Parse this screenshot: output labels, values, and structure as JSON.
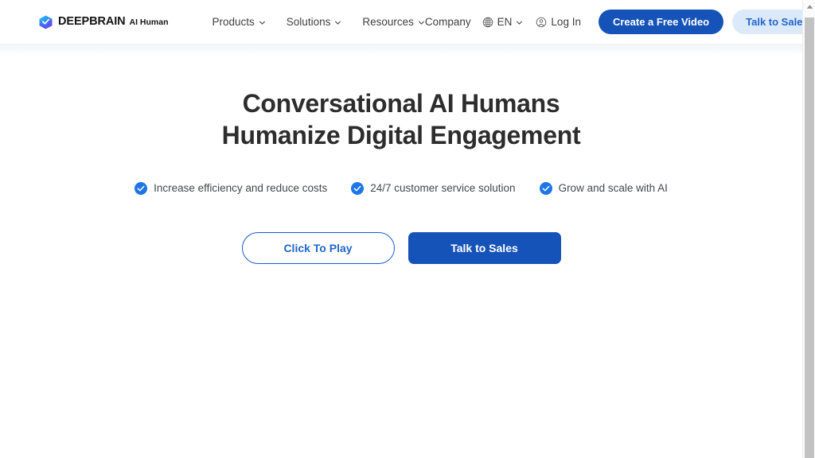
{
  "brand": {
    "logo_icon": "deepbrain-cube-icon",
    "name": "DEEPBRAIN",
    "product": "AI Human",
    "colors": {
      "primary_blue": "#1653b8",
      "link_blue": "#2266cc",
      "soft_blue_bg": "#dce9fa",
      "outline_blue": "#1a5bc4",
      "check_blue": "#1d75e8",
      "heading": "#2d2d2d",
      "body_text": "#44474d",
      "nav_text": "#3f3f3f"
    }
  },
  "header": {
    "nav": [
      {
        "label": "Products",
        "icon": "chevron-down-icon"
      },
      {
        "label": "Solutions",
        "icon": "chevron-down-icon"
      },
      {
        "label": "Resources",
        "icon": "chevron-down-icon"
      }
    ],
    "company_label": "Company",
    "language": {
      "icon": "globe-icon",
      "value": "EN",
      "chevron": "chevron-down-icon"
    },
    "login": {
      "icon": "user-circle-icon",
      "label": "Log In"
    },
    "cta_primary": "Create a Free Video",
    "cta_secondary": "Talk to Sales"
  },
  "hero": {
    "headline_line1": "Conversational AI Humans",
    "headline_line2": "Humanize Digital Engagement",
    "features": [
      {
        "icon": "check-circle-icon",
        "label": "Increase efficiency and reduce costs"
      },
      {
        "icon": "check-circle-icon",
        "label": "24/7 customer service solution"
      },
      {
        "icon": "check-circle-icon",
        "label": "Grow and scale with AI"
      }
    ],
    "cta_play": "Click To Play",
    "cta_sales": "Talk to Sales"
  },
  "scrollbar": {
    "up_arrow_icon": "scroll-up-arrow-icon",
    "thumb_label": "vertical-scroll-thumb"
  }
}
